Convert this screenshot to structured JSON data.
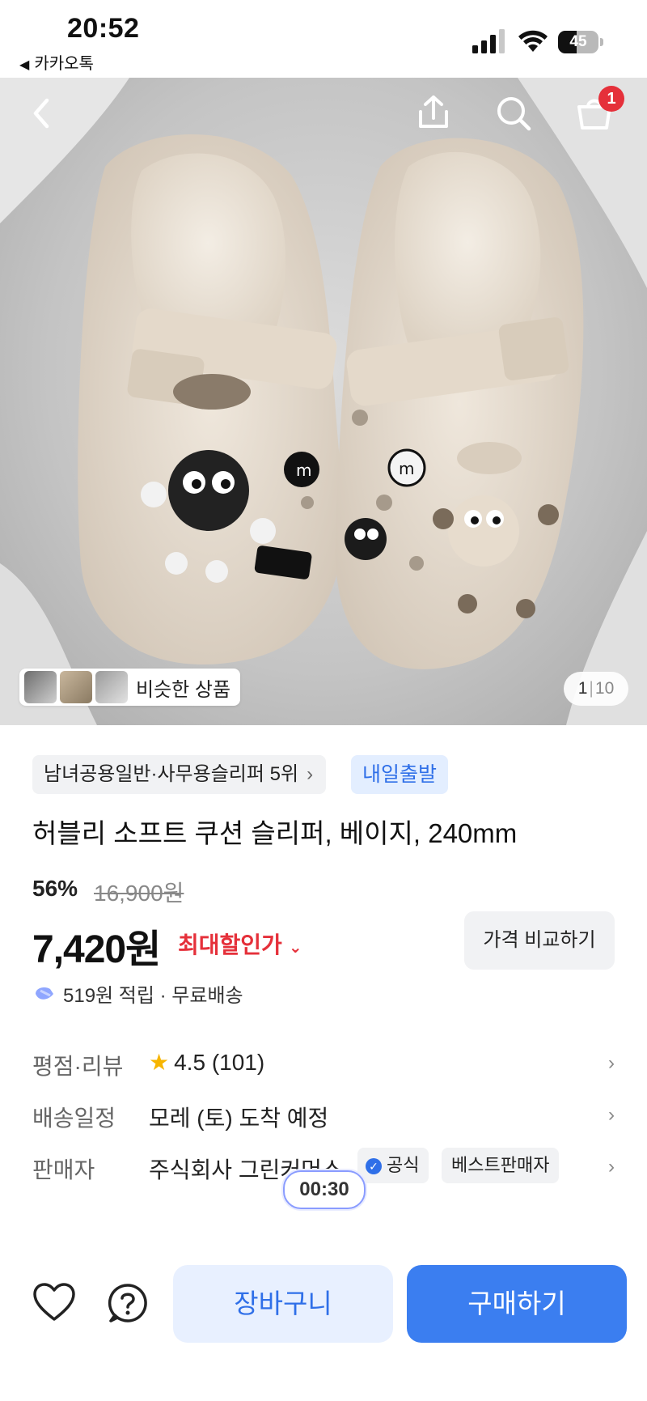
{
  "status_bar": {
    "time": "20:52",
    "back_app": "카카오톡",
    "battery": "45",
    "battery_level": 0.45
  },
  "hero": {
    "similar_label": "비슷한 상품",
    "page_current": "1",
    "page_total": "10",
    "cart_count": "1"
  },
  "product": {
    "rank_chip": "남녀공용일반·사무용슬리퍼 5위",
    "ship_chip": "내일출발",
    "title": "허블리 소프트 쿠션 슬리퍼, 베이지, 240mm",
    "discount": "56%",
    "original_price": "16,900원",
    "price": "7,420원",
    "max_discount_label": "최대할인가",
    "compare_label": "가격 비교하기",
    "reward_text": "519원 적립 · 무료배송"
  },
  "details": {
    "rating_key": "평점·리뷰",
    "rating_value": "4.5 (101)",
    "delivery_key": "배송일정",
    "delivery_value": "모레 (토) 도착 예정",
    "seller_key": "판매자",
    "seller_value": "주식회사 그린커머스",
    "official_badge": "공식",
    "best_badge": "베스트판매자"
  },
  "timer": "00:30",
  "actions": {
    "cart_label": "장바구니",
    "buy_label": "구매하기"
  },
  "colors": {
    "accent": "#3b7ef0",
    "sale_red": "#e5303a",
    "star": "#f7b500"
  }
}
